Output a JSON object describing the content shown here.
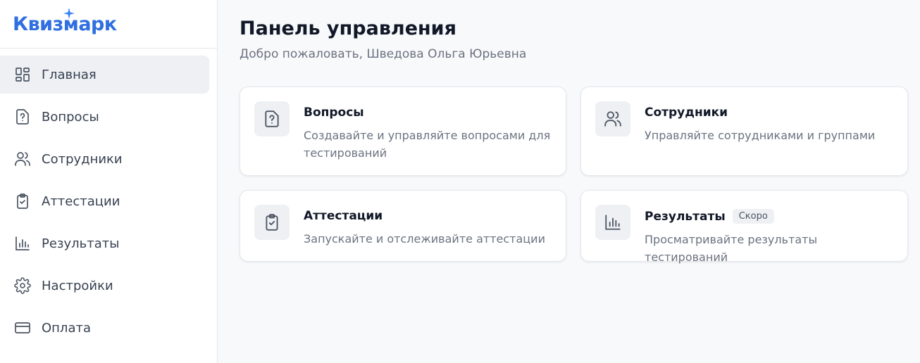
{
  "app": {
    "logo_text": "Квизмарк",
    "brand_color": "#2f6fe0"
  },
  "sidebar": {
    "items": [
      {
        "label": "Главная",
        "icon": "grid-icon",
        "active": true
      },
      {
        "label": "Вопросы",
        "icon": "question-file-icon"
      },
      {
        "label": "Сотрудники",
        "icon": "users-icon"
      },
      {
        "label": "Аттестации",
        "icon": "clipboard-check-icon"
      },
      {
        "label": "Результаты",
        "icon": "bar-chart-icon"
      },
      {
        "label": "Настройки",
        "icon": "gear-icon"
      },
      {
        "label": "Оплата",
        "icon": "credit-card-icon"
      }
    ]
  },
  "main": {
    "title": "Панель управления",
    "subtitle": "Добро пожаловать, Шведова Ольга Юрьевна",
    "cards": [
      {
        "title": "Вопросы",
        "description": "Создавайте и управляйте вопросами для тестирований",
        "icon": "question-file-icon"
      },
      {
        "title": "Сотрудники",
        "description": "Управляйте сотрудниками и группами",
        "icon": "users-icon"
      },
      {
        "title": "Аттестации",
        "description": "Запускайте и отслеживайте аттестации",
        "icon": "clipboard-check-icon"
      },
      {
        "title": "Результаты",
        "description": "Просматривайте результаты тестирований",
        "badge": "Скоро",
        "icon": "bar-chart-icon"
      }
    ]
  }
}
